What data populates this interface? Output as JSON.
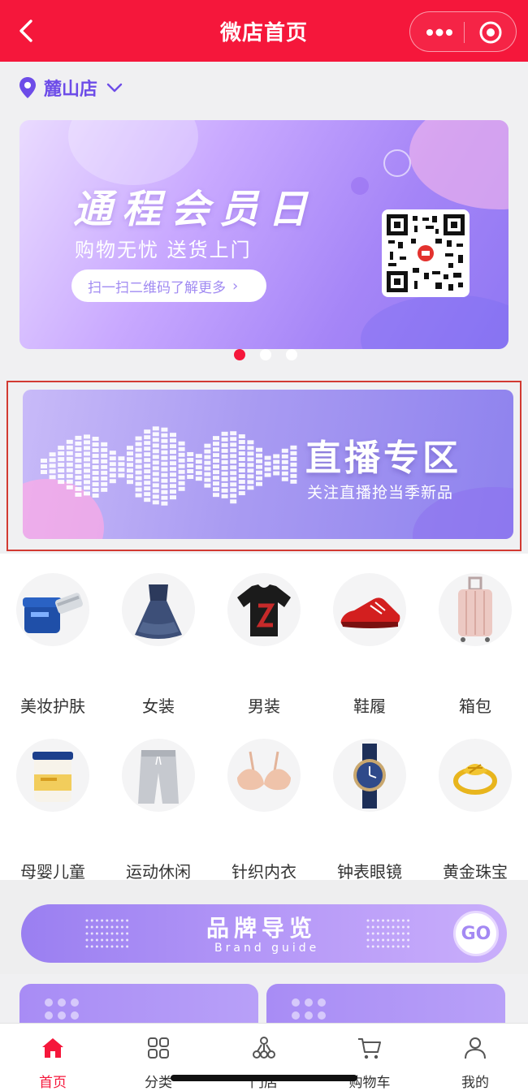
{
  "nav": {
    "title": "微店首页"
  },
  "store": {
    "name": "麓山店"
  },
  "banner": {
    "title": "通程会员日",
    "subtitle": "购物无忧 送货上门",
    "cta": "扫一扫二维码了解更多"
  },
  "carousel": {
    "total": 3,
    "active_index": 0
  },
  "live_zone": {
    "title": "直播专区",
    "subtitle": "关注直播抢当季新品"
  },
  "categories": [
    {
      "label": "美妆护肤",
      "icon": "skincare-jar-icon"
    },
    {
      "label": "女装",
      "icon": "dress-icon"
    },
    {
      "label": "男装",
      "icon": "tshirt-icon"
    },
    {
      "label": "鞋履",
      "icon": "sneaker-icon"
    },
    {
      "label": "箱包",
      "icon": "suitcase-icon"
    },
    {
      "label": "母婴儿童",
      "icon": "formula-can-icon"
    },
    {
      "label": "运动休闲",
      "icon": "shorts-icon"
    },
    {
      "label": "针织内衣",
      "icon": "bra-icon"
    },
    {
      "label": "钟表眼镜",
      "icon": "watch-icon"
    },
    {
      "label": "黄金珠宝",
      "icon": "gold-ring-icon"
    }
  ],
  "brand_guide": {
    "title": "品牌导览",
    "subtitle": "Brand guide",
    "go_label": "GO"
  },
  "tabbar": [
    {
      "label": "首页",
      "icon": "home-icon",
      "active": true
    },
    {
      "label": "分类",
      "icon": "grid-icon",
      "active": false
    },
    {
      "label": "门店",
      "icon": "store-network-icon",
      "active": false
    },
    {
      "label": "购物车",
      "icon": "cart-icon",
      "active": false
    },
    {
      "label": "我的",
      "icon": "user-icon",
      "active": false
    }
  ],
  "colors": {
    "brand_red": "#f5173b",
    "accent_purple": "#6d4ce8",
    "highlight_frame": "#d23a32"
  }
}
